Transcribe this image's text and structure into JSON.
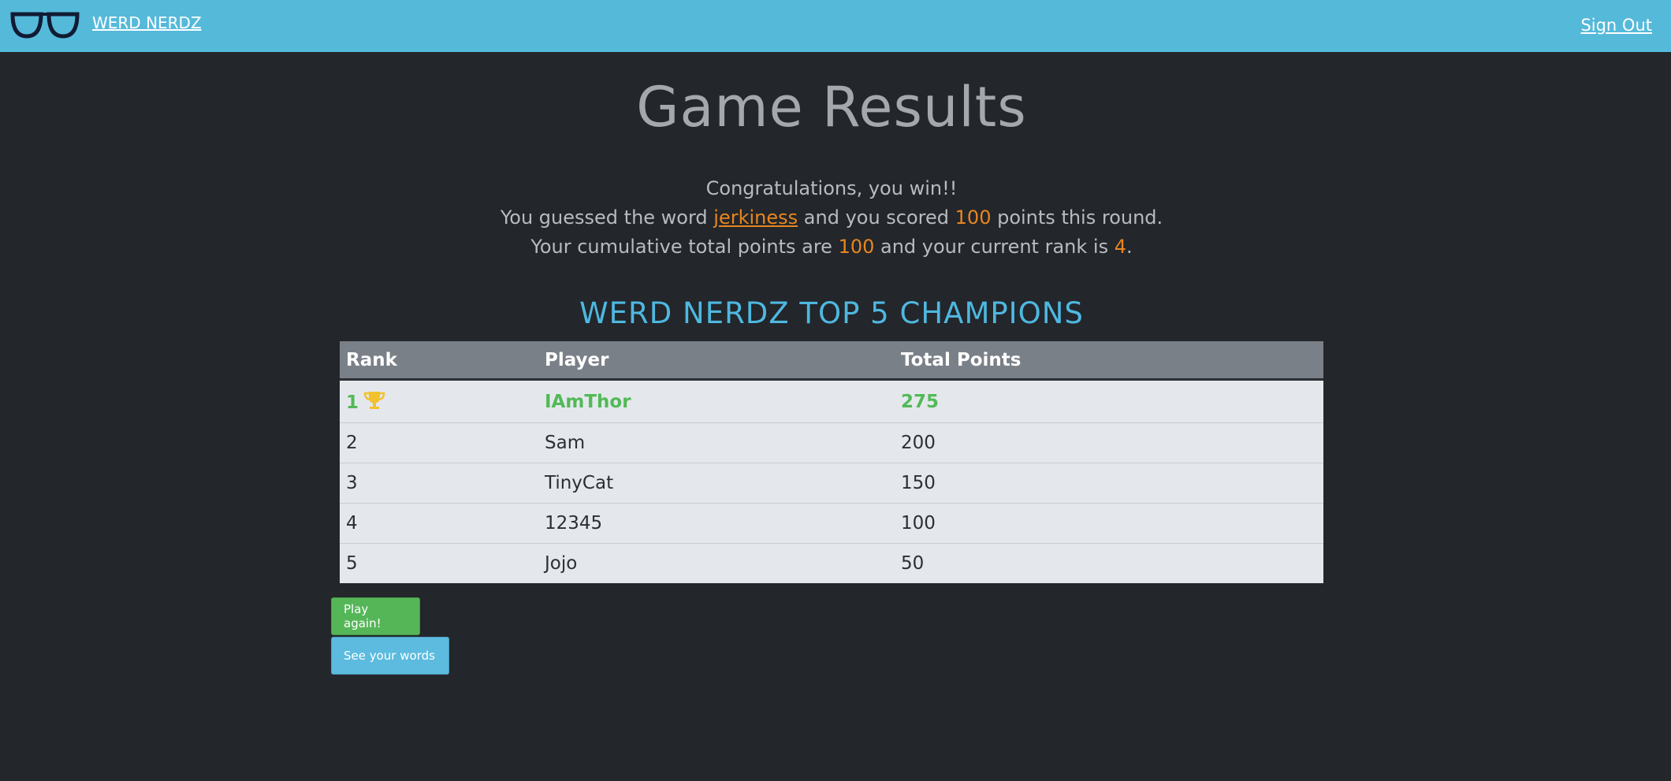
{
  "navbar": {
    "brand_icon": "glasses-icon",
    "brand_label": "WERD NERDZ",
    "signout_label": "Sign Out",
    "background": "#55b9da"
  },
  "page": {
    "title": "Game Results"
  },
  "message": {
    "line1": "Congratulations, you win!!",
    "line2_prefix": "You guessed the word ",
    "word": "jerkiness",
    "line2_mid": " and you scored ",
    "round_points": "100",
    "line2_suffix": " points this round.",
    "line3_prefix": "Your cumulative total points are ",
    "total_points": "100",
    "line3_mid": " and your current rank is ",
    "rank": "4",
    "line3_suffix": ".",
    "highlight_color": "#e8861f"
  },
  "leaderboard": {
    "title": "WERD NERDZ TOP 5 CHAMPIONS",
    "columns": [
      "Rank",
      "Player",
      "Total Points"
    ],
    "rows": [
      {
        "rank": "1",
        "player": "IAmThor",
        "points": "275",
        "icon": "trophy-icon"
      },
      {
        "rank": "2",
        "player": "Sam",
        "points": "200"
      },
      {
        "rank": "3",
        "player": "TinyCat",
        "points": "150"
      },
      {
        "rank": "4",
        "player": "12345",
        "points": "100"
      },
      {
        "rank": "5",
        "player": "Jojo",
        "points": "50"
      }
    ],
    "leader_color": "#52b957"
  },
  "actions": {
    "play_again_label": "Play again!",
    "see_words_label": "See your words"
  }
}
